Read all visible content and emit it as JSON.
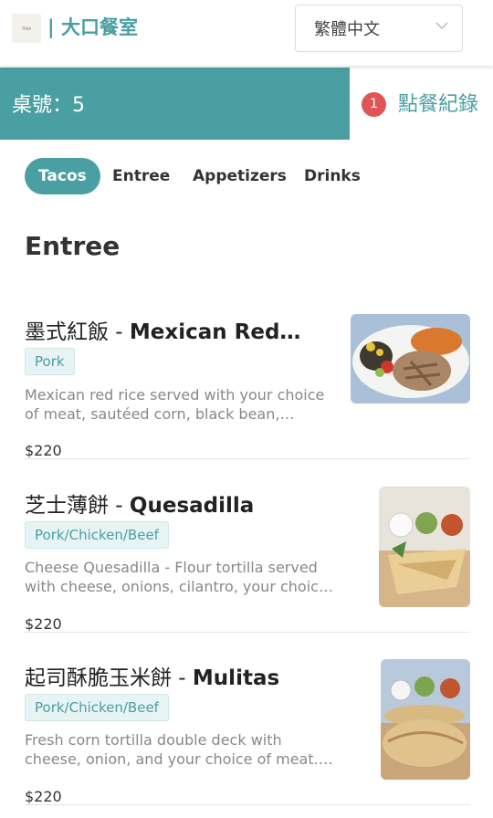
{
  "header": {
    "logo_text": "TAKA",
    "brand": "| 大口餐室",
    "language": "繁體中文"
  },
  "table_bar": {
    "label": "桌號：5",
    "order_count": "1",
    "order_history": "點餐紀錄"
  },
  "tabs": [
    {
      "label": "Tacos",
      "active": true
    },
    {
      "label": "Entree",
      "active": false
    },
    {
      "label": "Appetizers",
      "active": false
    },
    {
      "label": "Drinks",
      "active": false
    }
  ],
  "section_title": "Entree",
  "items": [
    {
      "name_zh": "墨式紅飯 - ",
      "name_en": "Mexican Red…",
      "tag": "Pork",
      "desc": "Mexican red rice served with your choice of meat, sautéed corn, black bean,…",
      "price": "$220"
    },
    {
      "name_zh": "芝士薄餅 - ",
      "name_en": "Quesadilla",
      "tag": "Pork/Chicken/Beef",
      "desc": "Cheese Quesadilla - Flour tortilla served with cheese, onions, cilantro, your choic…",
      "price": "$220"
    },
    {
      "name_zh": "起司酥脆玉米餅 - ",
      "name_en": "Mulitas",
      "tag": "Pork/Chicken/Beef",
      "desc": "Fresh corn tortilla double deck with cheese, onion, and your choice of meat.…",
      "price": "$220"
    }
  ],
  "colors": {
    "accent": "#4a9fa2",
    "badge": "#e05555"
  }
}
